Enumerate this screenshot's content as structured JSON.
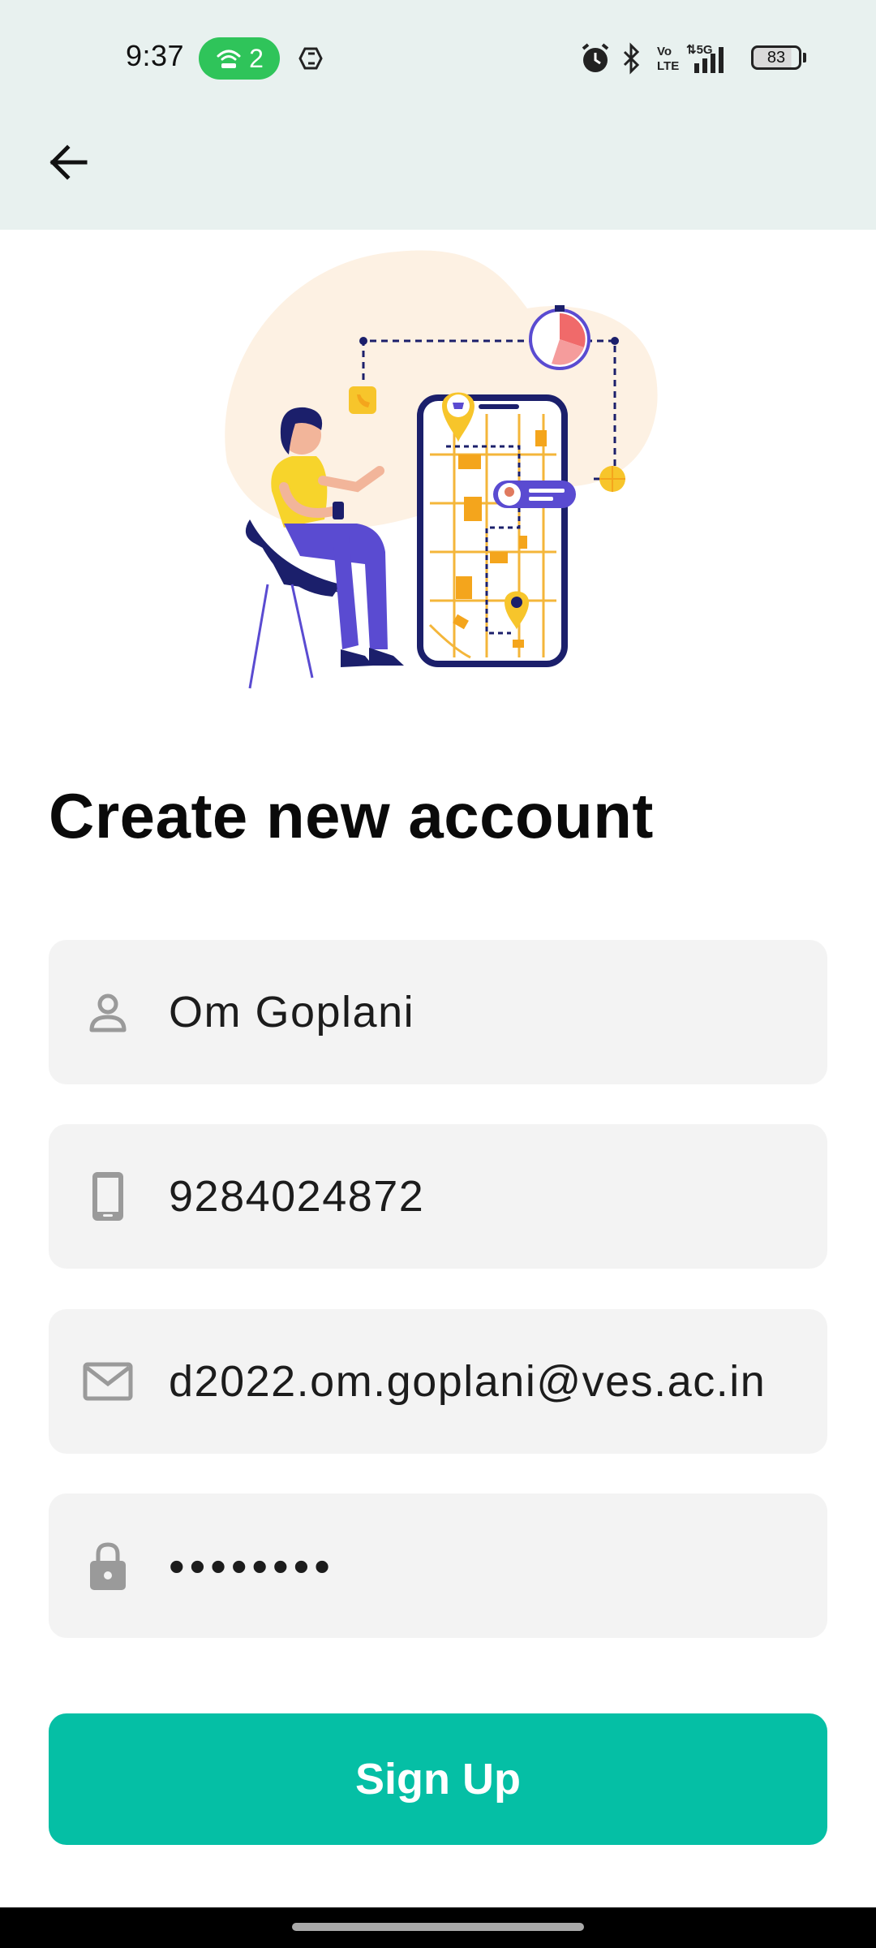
{
  "status_bar": {
    "time": "9:37",
    "hotspot_count": "2",
    "battery_level": "83",
    "icons": [
      "hotspot-icon",
      "sync-icon",
      "alarm-icon",
      "bluetooth-icon",
      "volte-icon",
      "5g-signal-icon",
      "battery-icon"
    ]
  },
  "app_bar": {
    "back_icon": "arrow-left-icon"
  },
  "form": {
    "title": "Create new account",
    "name": {
      "value": "Om Goplani",
      "icon": "person-icon"
    },
    "phone": {
      "value": "9284024872",
      "icon": "phone-icon"
    },
    "email": {
      "value": "d2022.om.goplani@ves.ac.in",
      "icon": "mail-icon"
    },
    "password": {
      "value": "••••••••",
      "icon": "lock-icon"
    },
    "submit_label": "Sign Up"
  },
  "colors": {
    "header_bg": "#e8f1ef",
    "accent": "#05bfa5",
    "field_bg": "#f3f3f3",
    "hotspot_pill": "#2fc45a"
  }
}
